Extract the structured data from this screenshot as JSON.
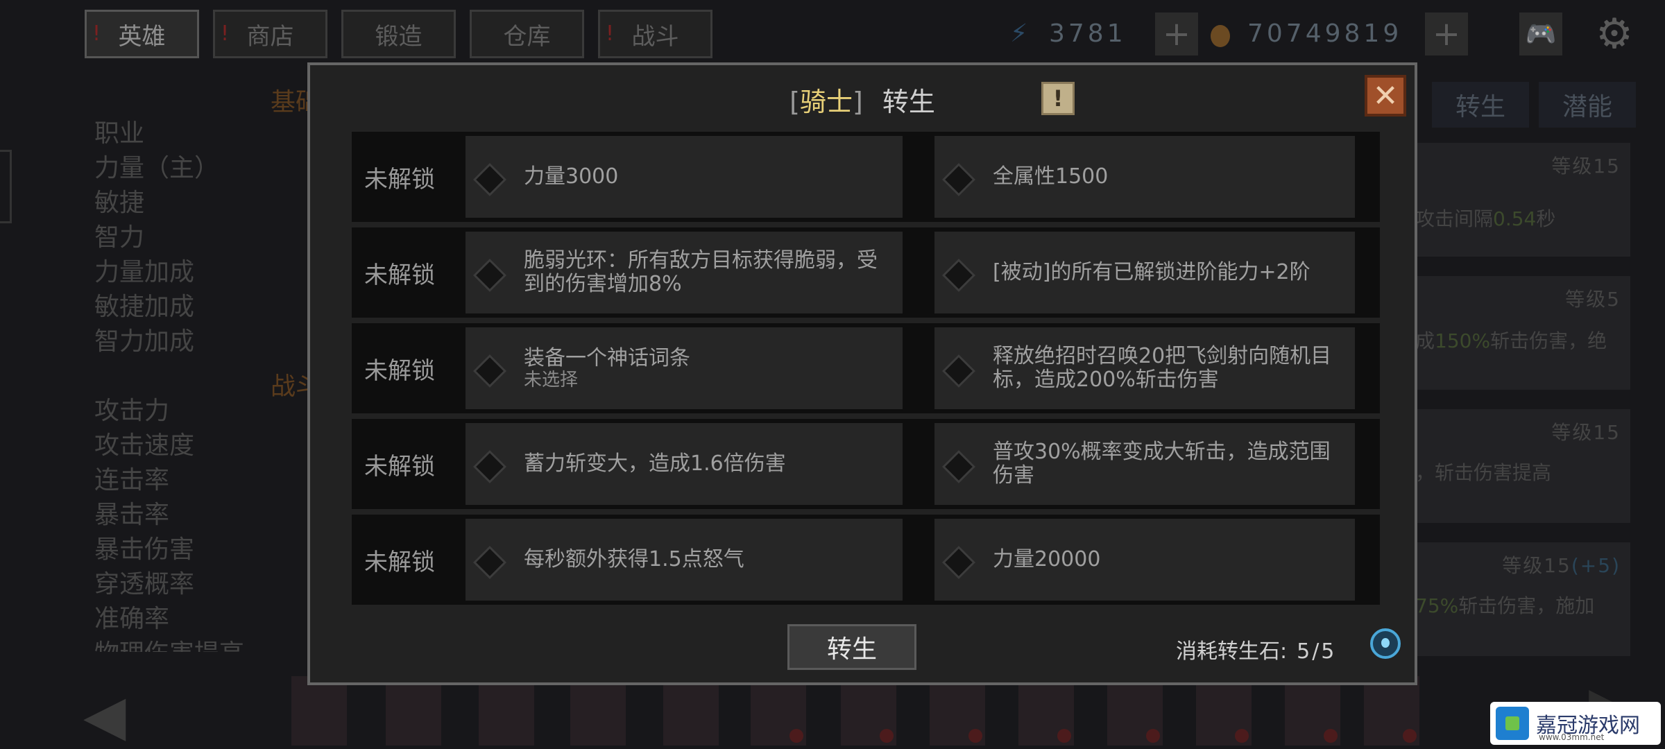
{
  "top_tabs": [
    {
      "label": "英雄",
      "warn": true,
      "active": true
    },
    {
      "label": "商店",
      "warn": true,
      "active": false
    },
    {
      "label": "锻造",
      "warn": false,
      "active": false
    },
    {
      "label": "仓库",
      "warn": false,
      "active": false
    },
    {
      "label": "战斗",
      "warn": true,
      "active": false
    }
  ],
  "resources": {
    "energy": "3781",
    "gold": "70749819",
    "plus": "+"
  },
  "stats": {
    "section_basic": "基础",
    "section_battle": "战斗",
    "items": [
      "职业",
      "力量（主）",
      "敏捷",
      "智力",
      "力量加成",
      "敏捷加成",
      "智力加成",
      "",
      "攻击力",
      "攻击速度",
      "连击率",
      "暴击率",
      "暴击伤害",
      "穿透概率",
      "准确率",
      "物理伤害提高"
    ]
  },
  "right_panel": {
    "tabs": [
      "转生",
      "潜能"
    ],
    "cards": [
      {
        "level": "等级15",
        "text_pre": "攻击间隔",
        "text_hl": "0.54",
        "text_post": "秒"
      },
      {
        "level": "等级5",
        "text_pre": "成",
        "text_hl": "150%",
        "text_post": "斩击伤害，绝"
      },
      {
        "level": "等级15",
        "text_pre": "，斩击伤害提高",
        "text_hl": "",
        "text_post": ""
      },
      {
        "level": "等级15",
        "level_bonus": "(+5)",
        "text_pre": "",
        "text_hl": "75%",
        "text_post": "斩击伤害，施加"
      }
    ]
  },
  "modal": {
    "title_bracket_open": "[",
    "title_class": "骑士",
    "title_bracket_close": "]",
    "title_action": "转生",
    "info_label": "!",
    "close_label": "✕",
    "rows": [
      {
        "status": "未解锁",
        "left": {
          "text": "力量3000",
          "sub": ""
        },
        "right": {
          "text": "全属性1500",
          "sub": ""
        }
      },
      {
        "status": "未解锁",
        "left": {
          "text": "脆弱光环：所有敌方目标获得脆弱，受到的伤害增加8%",
          "sub": ""
        },
        "right": {
          "text": "[被动]的所有已解锁进阶能力+2阶",
          "sub": ""
        }
      },
      {
        "status": "未解锁",
        "left": {
          "text": "装备一个神话词条",
          "sub": "未选择"
        },
        "right": {
          "text": "释放绝招时召唤20把飞剑射向随机目标，造成200%斩击伤害",
          "sub": ""
        }
      },
      {
        "status": "未解锁",
        "left": {
          "text": "蓄力斩变大，造成1.6倍伤害",
          "sub": ""
        },
        "right": {
          "text": "普攻30%概率变成大斩击，造成范围伤害",
          "sub": ""
        }
      },
      {
        "status": "未解锁",
        "left": {
          "text": "每秒额外获得1.5点怒气",
          "sub": ""
        },
        "right": {
          "text": "力量20000",
          "sub": ""
        }
      }
    ],
    "action_label": "转生",
    "cost_label": "消耗转生石:",
    "cost_value": "5/5"
  },
  "watermark": {
    "text": "嘉冠游戏网",
    "url": "www.03mm.net"
  },
  "colors": {
    "title_class": "#e8d078",
    "close_bg": "#a0502a",
    "stone": "#4aa7d8",
    "modal_border": "#666666"
  }
}
